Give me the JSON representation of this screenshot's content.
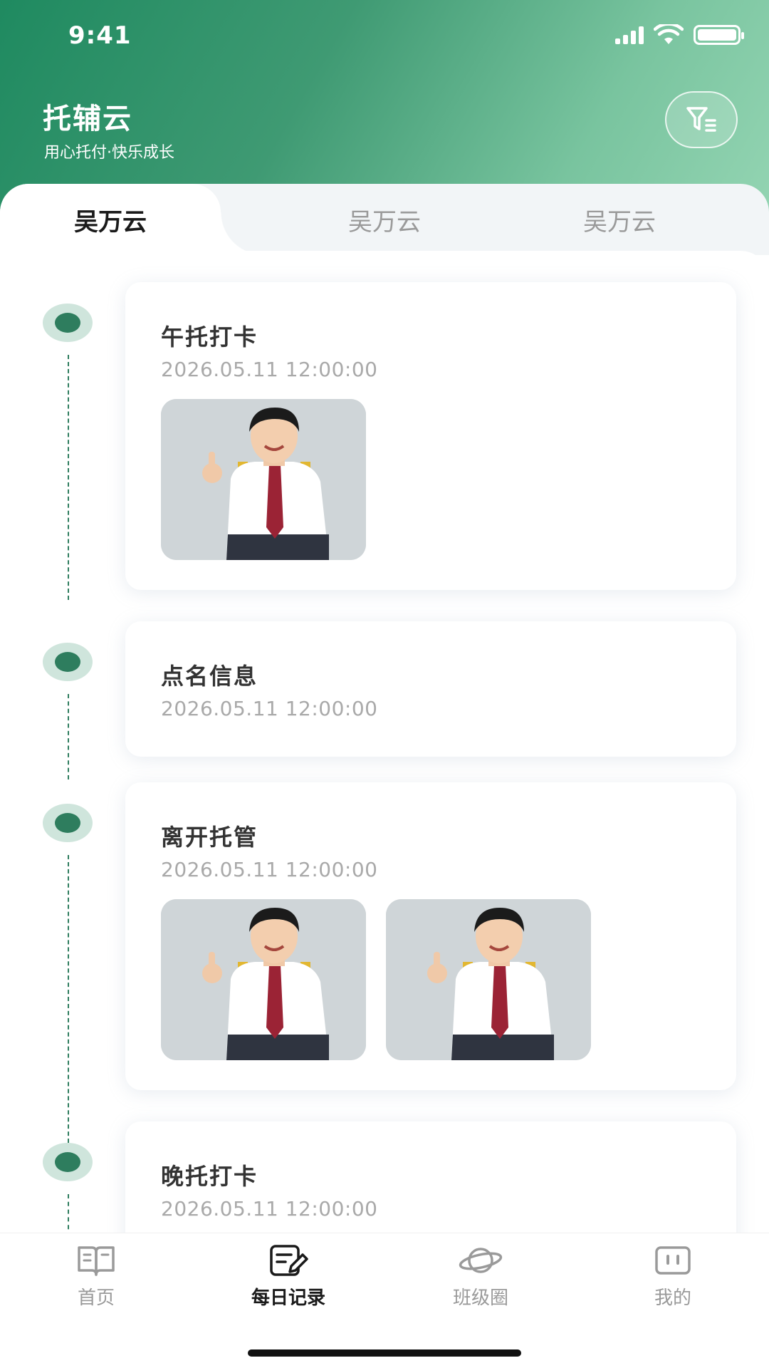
{
  "status_bar": {
    "time": "9:41"
  },
  "header": {
    "title": "托辅云",
    "subtitle": "用心托付·快乐成长",
    "filter_icon": "filter-icon"
  },
  "tabs": [
    {
      "label": "吴万云",
      "active": true
    },
    {
      "label": "吴万云",
      "active": false
    },
    {
      "label": "吴万云",
      "active": false
    }
  ],
  "records": [
    {
      "title": "午托打卡",
      "time": "2026.05.11 12:00:00",
      "photos": 1
    },
    {
      "title": "点名信息",
      "time": "2026.05.11 12:00:00",
      "photos": 0
    },
    {
      "title": "离开托管",
      "time": "2026.05.11 12:00:00",
      "photos": 2
    },
    {
      "title": "晚托打卡",
      "time": "2026.05.11 12:00:00",
      "photos": 0
    }
  ],
  "bottom_nav": [
    {
      "label": "首页",
      "icon": "book-icon",
      "active": false
    },
    {
      "label": "每日记录",
      "icon": "edit-note-icon",
      "active": true
    },
    {
      "label": "班级圈",
      "icon": "planet-icon",
      "active": false
    },
    {
      "label": "我的",
      "icon": "profile-icon",
      "active": false
    }
  ],
  "colors": {
    "accent": "#2e7d5e",
    "header_start": "#1f8a60",
    "header_end": "#93d4b2"
  }
}
